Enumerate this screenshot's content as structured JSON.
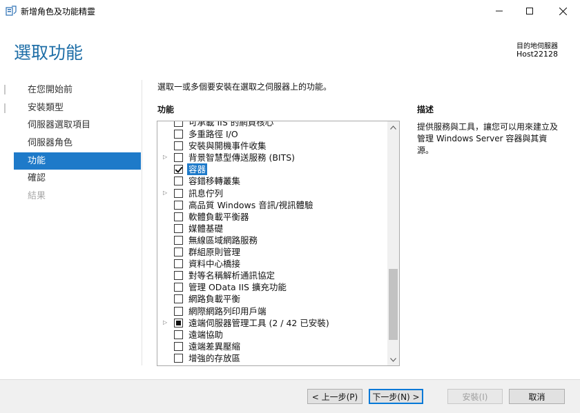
{
  "window": {
    "title": "新增角色及功能精靈",
    "icon": "server-manager-icon"
  },
  "header": {
    "page_title": "選取功能",
    "destination_label": "目的地伺服器",
    "destination_host": "Host22128"
  },
  "nav": {
    "items": [
      {
        "label": "在您開始前",
        "state": "normal"
      },
      {
        "label": "安裝類型",
        "state": "normal"
      },
      {
        "label": "伺服器選取項目",
        "state": "normal"
      },
      {
        "label": "伺服器角色",
        "state": "normal"
      },
      {
        "label": "功能",
        "state": "active"
      },
      {
        "label": "確認",
        "state": "normal"
      },
      {
        "label": "結果",
        "state": "disabled"
      }
    ]
  },
  "main": {
    "instruction": "選取一或多個要安裝在選取之伺服器上的功能。",
    "features_label": "功能",
    "features": [
      {
        "label": "可承載 IIS 的網頁核心",
        "checked": "none",
        "expander": false,
        "selected": false
      },
      {
        "label": "多重路徑 I/O",
        "checked": "none",
        "expander": false,
        "selected": false
      },
      {
        "label": "安裝與開機事件收集",
        "checked": "none",
        "expander": false,
        "selected": false
      },
      {
        "label": "背景智慧型傳送服務 (BITS)",
        "checked": "none",
        "expander": true,
        "selected": false
      },
      {
        "label": "容器",
        "checked": "checked",
        "expander": false,
        "selected": true
      },
      {
        "label": "容錯移轉叢集",
        "checked": "none",
        "expander": false,
        "selected": false
      },
      {
        "label": "訊息佇列",
        "checked": "none",
        "expander": true,
        "selected": false
      },
      {
        "label": "高品質 Windows 音訊/視訊體驗",
        "checked": "none",
        "expander": false,
        "selected": false
      },
      {
        "label": "軟體負載平衡器",
        "checked": "none",
        "expander": false,
        "selected": false
      },
      {
        "label": "媒體基礎",
        "checked": "none",
        "expander": false,
        "selected": false
      },
      {
        "label": "無線區域網路服務",
        "checked": "none",
        "expander": false,
        "selected": false
      },
      {
        "label": "群組原則管理",
        "checked": "none",
        "expander": false,
        "selected": false
      },
      {
        "label": "資料中心橋接",
        "checked": "none",
        "expander": false,
        "selected": false
      },
      {
        "label": "對等名稱解析通訊協定",
        "checked": "none",
        "expander": false,
        "selected": false
      },
      {
        "label": "管理 OData IIS 擴充功能",
        "checked": "none",
        "expander": false,
        "selected": false
      },
      {
        "label": "網路負載平衡",
        "checked": "none",
        "expander": false,
        "selected": false
      },
      {
        "label": "網際網路列印用戶端",
        "checked": "none",
        "expander": false,
        "selected": false
      },
      {
        "label": "遠端伺服器管理工具 (2 / 42 已安裝)",
        "checked": "partial",
        "expander": true,
        "selected": false
      },
      {
        "label": "遠端協助",
        "checked": "none",
        "expander": false,
        "selected": false
      },
      {
        "label": "遠端差異壓縮",
        "checked": "none",
        "expander": false,
        "selected": false
      },
      {
        "label": "增強的存放區",
        "checked": "none",
        "expander": false,
        "selected": false
      }
    ],
    "description_label": "描述",
    "description_text": "提供服務與工具，讓您可以用來建立及管理 Windows Server 容器與其資源。"
  },
  "footer": {
    "prev_label": "< 上一步(P)",
    "next_label": "下一步(N) >",
    "install_label": "安裝(I)",
    "cancel_label": "取消"
  },
  "colors": {
    "accent": "#1e7ac9",
    "title_blue": "#1e6ea7"
  }
}
